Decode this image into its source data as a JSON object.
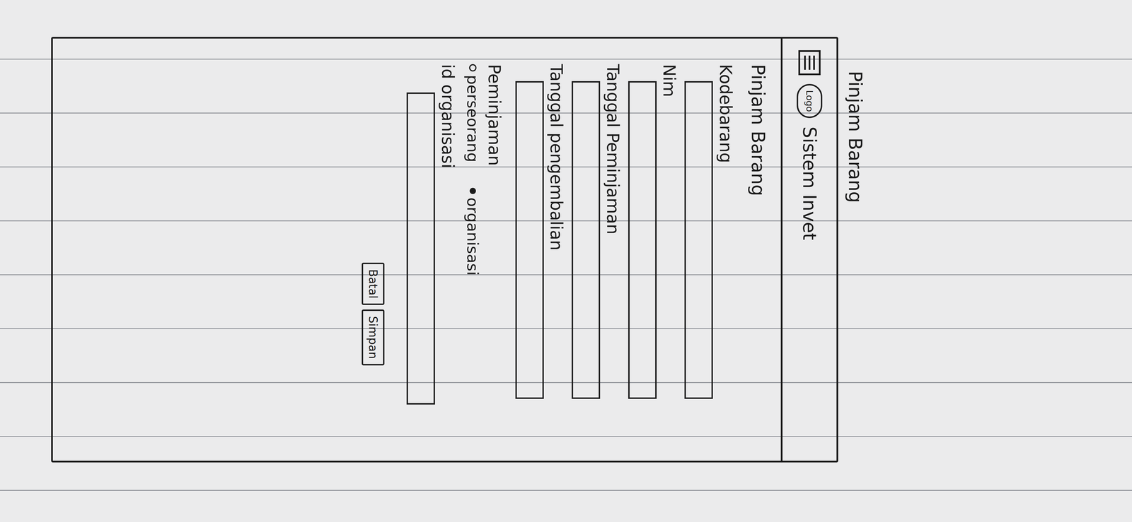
{
  "page_title": "Pinjam Barang",
  "app_bar": {
    "logo": "Logo",
    "title": "Sistem Invet"
  },
  "form": {
    "heading": "Pinjam Barang",
    "fields": [
      {
        "label": "Kodebarang"
      },
      {
        "label": "Nim"
      },
      {
        "label": "Tanggal Peminjaman"
      },
      {
        "label": "Tanggal pengembalian"
      }
    ],
    "radio_group": {
      "label": "Peminjaman",
      "options": [
        {
          "label": "perseorang",
          "selected": false
        },
        {
          "label": "organisasi",
          "selected": true
        }
      ]
    },
    "extra_field": {
      "label": "id organisasi"
    }
  },
  "buttons": [
    {
      "label": "Batal"
    },
    {
      "label": "Simpan"
    }
  ]
}
